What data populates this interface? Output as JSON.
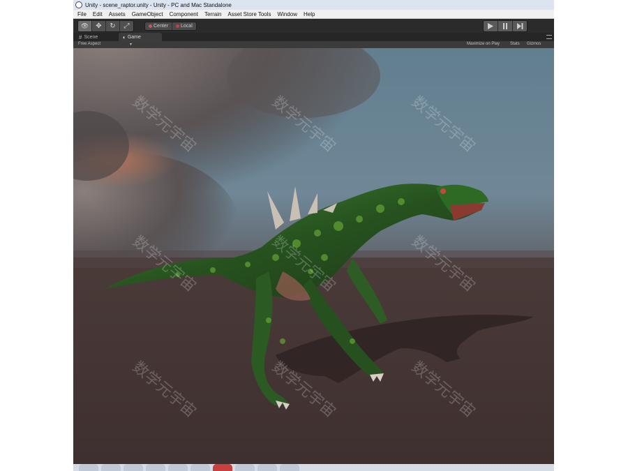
{
  "window": {
    "title": "Unity - scene_raptor.unity - Unity - PC and Mac Standalone"
  },
  "menu": {
    "items": [
      "File",
      "Edit",
      "Assets",
      "GameObject",
      "Component",
      "Terrain",
      "Asset Store Tools",
      "Window",
      "Help"
    ]
  },
  "toolbar": {
    "tools": [
      {
        "icon": "eye-icon",
        "glyph": "👁"
      },
      {
        "icon": "move-icon",
        "glyph": "✥"
      },
      {
        "icon": "rotate-icon",
        "glyph": "↻"
      },
      {
        "icon": "scale-icon",
        "glyph": "⤢"
      }
    ],
    "pivot_label": "Center",
    "space_label": "Local"
  },
  "tabs": {
    "scene": "Scene",
    "game": "Game"
  },
  "game_bar": {
    "aspect": "Free Aspect",
    "maximize": "Maximize on Play",
    "stats": "Stats",
    "gizmos": "Gizmos"
  },
  "watermark": {
    "text": "数学元宇宙"
  },
  "colors": {
    "sky_top": "#6f8797",
    "sky_bottom": "#524a4a",
    "ground": "#4b3b39",
    "raptor_green": "#2e5a25",
    "raptor_highlight": "#6fb13a"
  }
}
